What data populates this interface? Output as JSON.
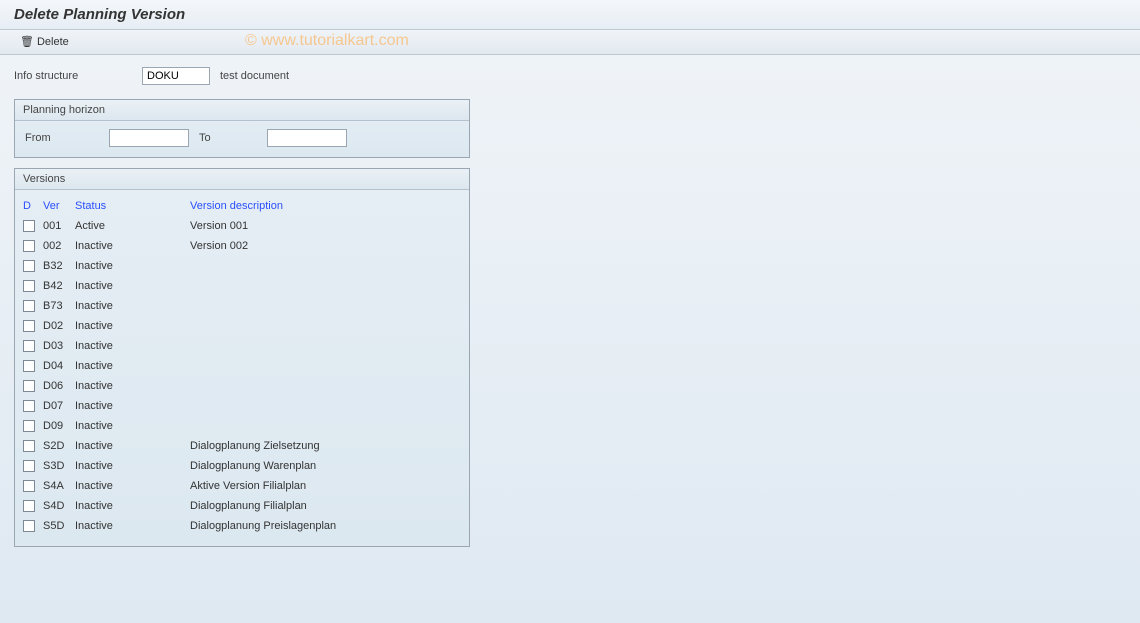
{
  "header": {
    "title": "Delete Planning Version"
  },
  "toolbar": {
    "delete_label": "Delete"
  },
  "watermark": "© www.tutorialkart.com",
  "info": {
    "label": "Info structure",
    "value": "DOKU",
    "desc": "test document"
  },
  "horizon": {
    "title": "Planning horizon",
    "from_label": "From",
    "from_value": "",
    "to_label": "To",
    "to_value": ""
  },
  "versions": {
    "title": "Versions",
    "cols": {
      "d": "D",
      "ver": "Ver",
      "status": "Status",
      "desc": "Version description"
    },
    "rows": [
      {
        "ver": "001",
        "status": "Active",
        "desc": "Version 001"
      },
      {
        "ver": "002",
        "status": "Inactive",
        "desc": "Version 002"
      },
      {
        "ver": "B32",
        "status": "Inactive",
        "desc": ""
      },
      {
        "ver": "B42",
        "status": "Inactive",
        "desc": ""
      },
      {
        "ver": "B73",
        "status": "Inactive",
        "desc": ""
      },
      {
        "ver": "D02",
        "status": "Inactive",
        "desc": ""
      },
      {
        "ver": "D03",
        "status": "Inactive",
        "desc": ""
      },
      {
        "ver": "D04",
        "status": "Inactive",
        "desc": ""
      },
      {
        "ver": "D06",
        "status": "Inactive",
        "desc": ""
      },
      {
        "ver": "D07",
        "status": "Inactive",
        "desc": ""
      },
      {
        "ver": "D09",
        "status": "Inactive",
        "desc": ""
      },
      {
        "ver": "S2D",
        "status": "Inactive",
        "desc": "Dialogplanung Zielsetzung"
      },
      {
        "ver": "S3D",
        "status": "Inactive",
        "desc": "Dialogplanung Warenplan"
      },
      {
        "ver": "S4A",
        "status": "Inactive",
        "desc": "Aktive Version Filialplan"
      },
      {
        "ver": "S4D",
        "status": "Inactive",
        "desc": "Dialogplanung Filialplan"
      },
      {
        "ver": "S5D",
        "status": "Inactive",
        "desc": "Dialogplanung Preislagenplan"
      }
    ]
  }
}
